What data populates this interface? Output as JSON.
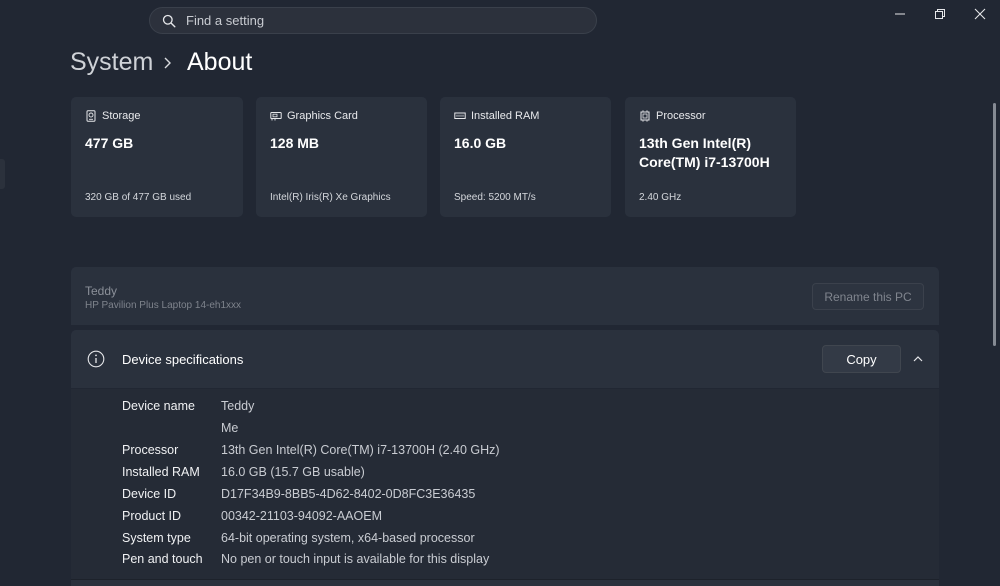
{
  "search": {
    "placeholder": "Find a setting"
  },
  "window_controls": {
    "minimize_icon": "minimize-icon",
    "maximize_icon": "restore-icon",
    "close_icon": "close-icon"
  },
  "breadcrumb": {
    "parent": "System",
    "current": "About"
  },
  "cards": [
    {
      "icon": "storage-icon",
      "title": "Storage",
      "value": "477 GB",
      "sub": "320 GB of 477 GB used"
    },
    {
      "icon": "graphics-card-icon",
      "title": "Graphics Card",
      "value": "128 MB",
      "sub": "Intel(R) Iris(R) Xe Graphics"
    },
    {
      "icon": "ram-icon",
      "title": "Installed RAM",
      "value": "16.0 GB",
      "sub": "Speed: 5200 MT/s"
    },
    {
      "icon": "processor-icon",
      "title": "Processor",
      "value": "13th Gen Intel(R) Core(TM) i7-13700H",
      "sub": "2.40 GHz"
    }
  ],
  "device": {
    "name": "Teddy",
    "model": "HP Pavilion Plus Laptop 14-eh1xxx",
    "rename_label": "Rename this PC"
  },
  "specs": {
    "title": "Device specifications",
    "copy_label": "Copy",
    "rows": [
      {
        "label": "Device name",
        "value": "Teddy"
      },
      {
        "label": "",
        "value": "Me"
      },
      {
        "label": "Processor",
        "value": "13th Gen Intel(R) Core(TM) i7-13700H (2.40 GHz)"
      },
      {
        "label": "Installed RAM",
        "value": "16.0 GB (15.7 GB usable)"
      },
      {
        "label": "Device ID",
        "value": "D17F34B9-8BB5-4D62-8402-0D8FC3E36435"
      },
      {
        "label": "Product ID",
        "value": "00342-21103-94092-AAOEM"
      },
      {
        "label": "System type",
        "value": "64-bit operating system, x64-based processor"
      },
      {
        "label": "Pen and touch",
        "value": "No pen or touch input is available for this display"
      }
    ]
  },
  "colors": {
    "background": "#212733",
    "card": "#2a313d",
    "accent_text": "#ffffff"
  }
}
